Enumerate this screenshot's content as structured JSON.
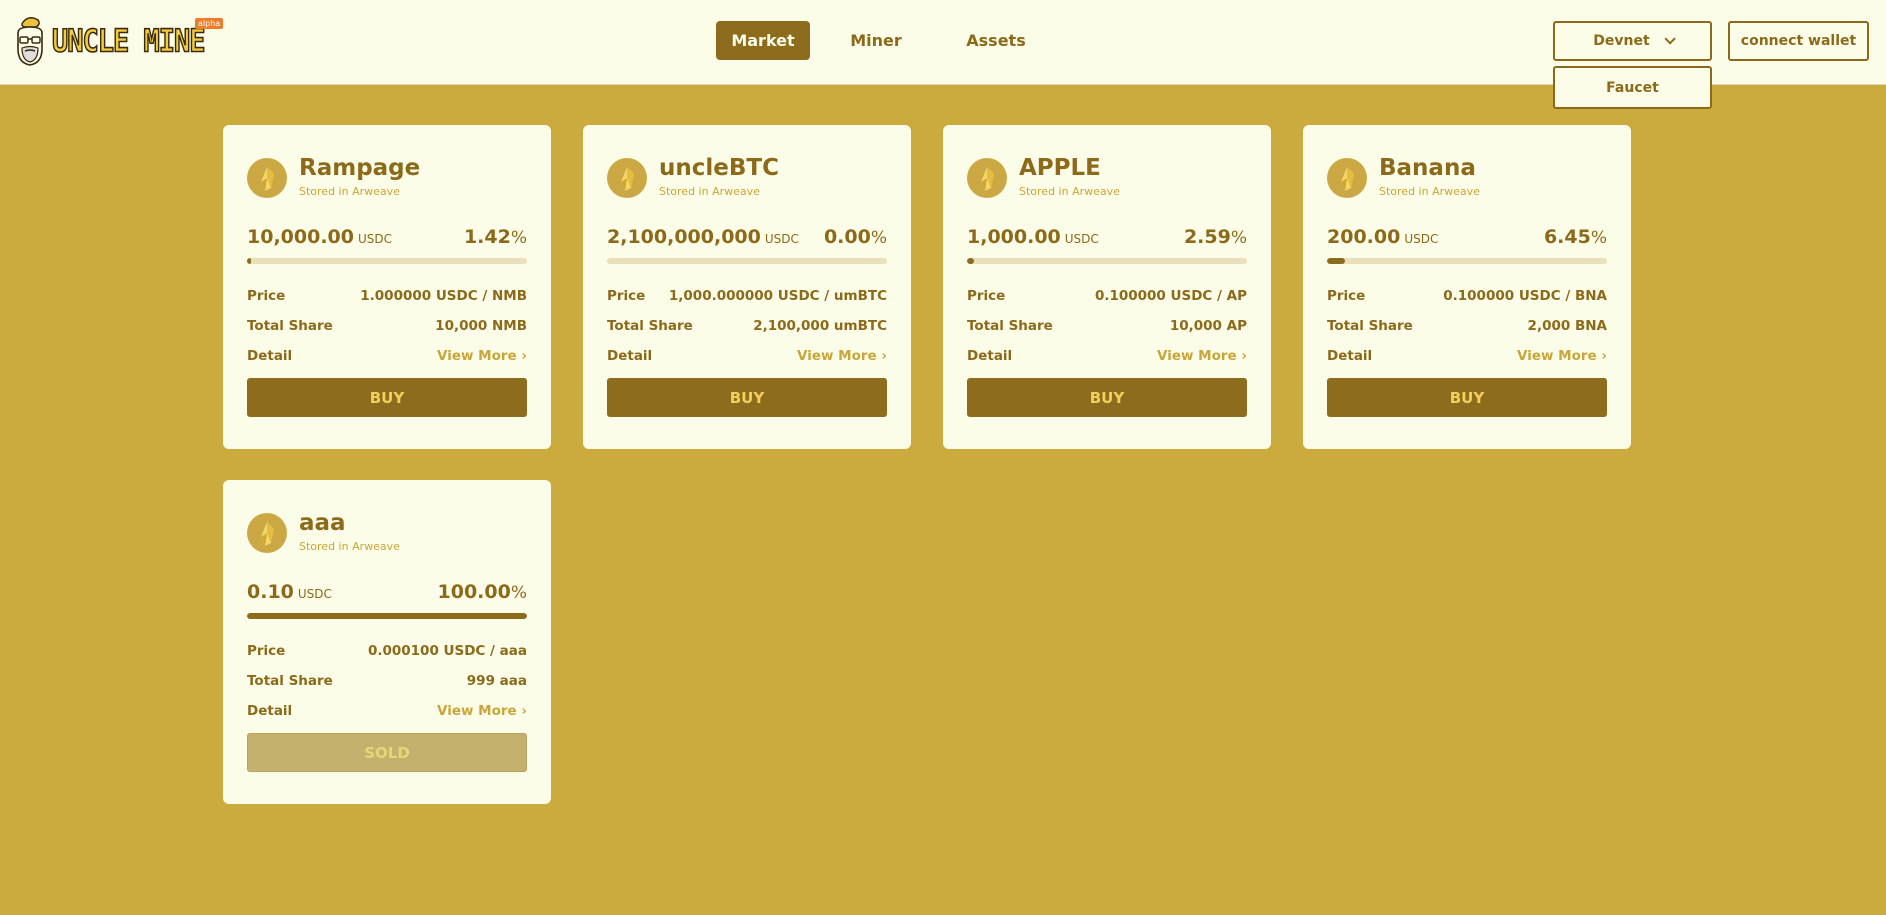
{
  "header": {
    "logo_text": "UNCLE MINE",
    "badge": "alpha",
    "nav": [
      "Market",
      "Miner",
      "Assets"
    ],
    "network": "Devnet",
    "faucet": "Faucet",
    "wallet": "connect wallet"
  },
  "colors": {
    "accent": "#8e6c1d",
    "background": "#cbab3e",
    "card": "#fbfde8",
    "muted": "#c9a63a"
  },
  "cards": [
    {
      "name": "Rampage",
      "sub": "Stored in Arweave",
      "amount": "10,000.00",
      "unit": "USDC",
      "pct": "1.42",
      "pct_sign": "%",
      "progress": 0.0142,
      "price_label": "Price",
      "price": "1.000000 USDC / NMB",
      "share_label": "Total Share",
      "share": "10,000 NMB",
      "detail_label": "Detail",
      "detail_link": "View More",
      "button": "BUY"
    },
    {
      "name": "uncleBTC",
      "sub": "Stored in Arweave",
      "amount": "2,100,000,000",
      "unit": "USDC",
      "pct": "0.00",
      "pct_sign": "%",
      "progress": 0.0,
      "price_label": "Price",
      "price": "1,000.000000 USDC / umBTC",
      "share_label": "Total Share",
      "share": "2,100,000 umBTC",
      "detail_label": "Detail",
      "detail_link": "View More",
      "button": "BUY"
    },
    {
      "name": "APPLE",
      "sub": "Stored in Arweave",
      "amount": "1,000.00",
      "unit": "USDC",
      "pct": "2.59",
      "pct_sign": "%",
      "progress": 0.0259,
      "price_label": "Price",
      "price": "0.100000 USDC / AP",
      "share_label": "Total Share",
      "share": "10,000 AP",
      "detail_label": "Detail",
      "detail_link": "View More",
      "button": "BUY"
    },
    {
      "name": "Banana",
      "sub": "Stored in Arweave",
      "amount": "200.00",
      "unit": "USDC",
      "pct": "6.45",
      "pct_sign": "%",
      "progress": 0.0645,
      "price_label": "Price",
      "price": "0.100000 USDC / BNA",
      "share_label": "Total Share",
      "share": "2,000 BNA",
      "detail_label": "Detail",
      "detail_link": "View More",
      "button": "BUY"
    },
    {
      "name": "aaa",
      "sub": "Stored in Arweave",
      "amount": "0.10",
      "unit": "USDC",
      "pct": "100.00",
      "pct_sign": "%",
      "progress": 1.0,
      "price_label": "Price",
      "price": "0.000100 USDC / aaa",
      "share_label": "Total Share",
      "share": "999 aaa",
      "detail_label": "Detail",
      "detail_link": "View More",
      "button": "SOLD"
    }
  ]
}
